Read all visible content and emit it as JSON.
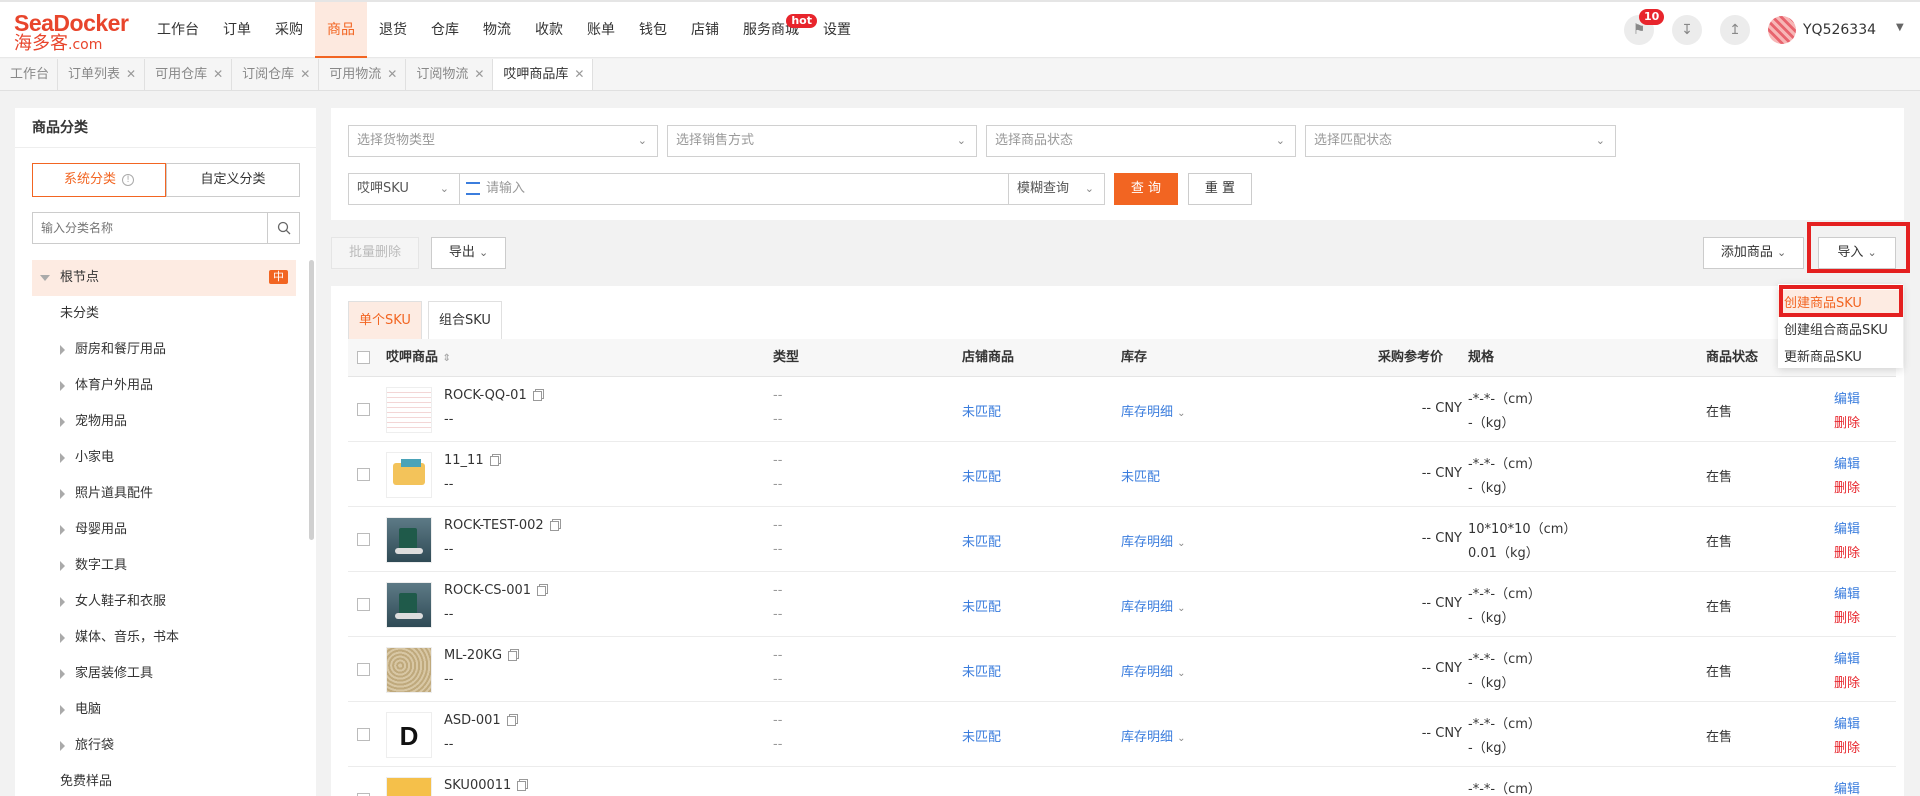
{
  "brand": {
    "name_en": "SeaDocker",
    "name_cn": "海多客",
    "suffix": ".com"
  },
  "nav": [
    "工作台",
    "订单",
    "采购",
    "商品",
    "退货",
    "仓库",
    "物流",
    "收款",
    "账单",
    "钱包",
    "店铺",
    "服务商城",
    "设置"
  ],
  "nav_active": "商品",
  "nav_hot_badge": "hot",
  "header": {
    "notification_count": "10",
    "username": "YQ526334"
  },
  "tabs": [
    {
      "label": "工作台",
      "closable": false
    },
    {
      "label": "订单列表",
      "closable": true
    },
    {
      "label": "可用仓库",
      "closable": true
    },
    {
      "label": "订阅仓库",
      "closable": true
    },
    {
      "label": "可用物流",
      "closable": true
    },
    {
      "label": "订阅物流",
      "closable": true
    },
    {
      "label": "哎呷商品库",
      "closable": true
    }
  ],
  "sidebar": {
    "title": "商品分类",
    "seg_system": "系统分类",
    "seg_custom": "自定义分类",
    "search_placeholder": "输入分类名称",
    "root": "根节点",
    "root_badge": "中",
    "items": [
      {
        "label": "未分类",
        "expandable": false
      },
      {
        "label": "厨房和餐厅用品",
        "expandable": true
      },
      {
        "label": "体育户外用品",
        "expandable": true
      },
      {
        "label": "宠物用品",
        "expandable": true
      },
      {
        "label": "小家电",
        "expandable": true
      },
      {
        "label": "照片道具配件",
        "expandable": true
      },
      {
        "label": "母婴用品",
        "expandable": true
      },
      {
        "label": "数字工具",
        "expandable": true
      },
      {
        "label": "女人鞋子和衣服",
        "expandable": true
      },
      {
        "label": "媒体、音乐，书本",
        "expandable": true
      },
      {
        "label": "家居装修工具",
        "expandable": true
      },
      {
        "label": "电脑",
        "expandable": true
      },
      {
        "label": "旅行袋",
        "expandable": true
      },
      {
        "label": "免费样品",
        "expandable": false
      }
    ]
  },
  "filters": {
    "goods_type": "选择货物类型",
    "sale_mode": "选择销售方式",
    "product_status": "选择商品状态",
    "match_status": "选择匹配状态",
    "sku_type": "哎呷SKU",
    "search_placeholder": "请输入",
    "query_mode": "模糊查询",
    "query_btn": "查 询",
    "reset_btn": "重 置"
  },
  "actions": {
    "batch_delete": "批量删除",
    "export": "导出",
    "add_product": "添加商品",
    "import": "导入"
  },
  "import_menu": [
    "创建商品SKU",
    "创建组合商品SKU",
    "更新商品SKU"
  ],
  "sku_tabs": [
    "单个SKU",
    "组合SKU"
  ],
  "columns": [
    "哎呷商品",
    "类型",
    "店铺商品",
    "库存",
    "采购参考价",
    "规格",
    "商品状态"
  ],
  "rows": [
    {
      "sku": "ROCK-QQ-01",
      "sub": "--",
      "type1": "--",
      "type2": "--",
      "store": "未匹配",
      "stock": "库存明细",
      "stock_arrow": true,
      "price": "-- CNY",
      "spec1": "-*-*-（cm）",
      "spec2": "-（kg）",
      "status": "在售",
      "edit": "编辑",
      "del": "删除",
      "thumb": "doc"
    },
    {
      "sku": "11_11",
      "sub": "--",
      "type1": "--",
      "type2": "--",
      "store": "未匹配",
      "stock": "未匹配",
      "stock_arrow": false,
      "price": "-- CNY",
      "spec1": "-*-*-（cm）",
      "spec2": "-（kg）",
      "status": "在售",
      "edit": "编辑",
      "del": "删除",
      "thumb": "box"
    },
    {
      "sku": "ROCK-TEST-002",
      "sub": "--",
      "type1": "--",
      "type2": "--",
      "store": "未匹配",
      "stock": "库存明细",
      "stock_arrow": true,
      "price": "-- CNY",
      "spec1": "10*10*10（cm）",
      "spec2": "0.01（kg）",
      "status": "在售",
      "edit": "编辑",
      "del": "删除",
      "thumb": "mug"
    },
    {
      "sku": "ROCK-CS-001",
      "sub": "--",
      "type1": "--",
      "type2": "--",
      "store": "未匹配",
      "stock": "库存明细",
      "stock_arrow": true,
      "price": "-- CNY",
      "spec1": "-*-*-（cm）",
      "spec2": "-（kg）",
      "status": "在售",
      "edit": "编辑",
      "del": "删除",
      "thumb": "mug"
    },
    {
      "sku": "ML-20KG",
      "sub": "--",
      "type1": "--",
      "type2": "--",
      "store": "未匹配",
      "stock": "库存明细",
      "stock_arrow": true,
      "price": "-- CNY",
      "spec1": "-*-*-（cm）",
      "spec2": "-（kg）",
      "status": "在售",
      "edit": "编辑",
      "del": "删除",
      "thumb": "sand"
    },
    {
      "sku": "ASD-001",
      "sub": "--",
      "type1": "--",
      "type2": "--",
      "store": "未匹配",
      "stock": "库存明细",
      "stock_arrow": true,
      "price": "-- CNY",
      "spec1": "-*-*-（cm）",
      "spec2": "-（kg）",
      "status": "在售",
      "edit": "编辑",
      "del": "删除",
      "thumb": "logo"
    },
    {
      "sku": "SKU00011",
      "sub": "",
      "type1": "",
      "type2": "",
      "store": "",
      "stock": "",
      "stock_arrow": false,
      "price": "",
      "spec1": "-*-*-（cm）",
      "spec2": "",
      "status": "",
      "edit": "编辑",
      "del": "",
      "thumb": "yellow"
    }
  ]
}
